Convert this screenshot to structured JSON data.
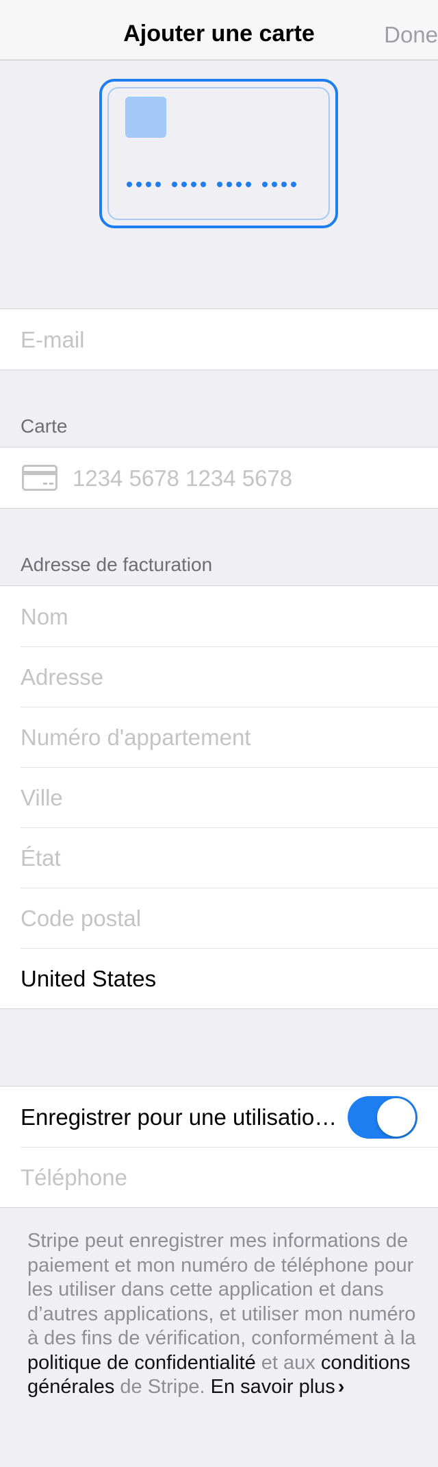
{
  "navbar": {
    "title": "Ajouter une carte",
    "done_label": "Done"
  },
  "email": {
    "placeholder": "E-mail"
  },
  "card_section": {
    "header": "Carte",
    "number_placeholder": "1234 5678 1234 5678"
  },
  "billing": {
    "header": "Adresse de facturation",
    "name_placeholder": "Nom",
    "address_placeholder": "Adresse",
    "apartment_placeholder": "Numéro d'appartement",
    "city_placeholder": "Ville",
    "state_placeholder": "État",
    "postal_placeholder": "Code postal",
    "country_value": "United States"
  },
  "save": {
    "label": "Enregistrer pour une utilisation ultérieure",
    "toggle_on": true,
    "phone_placeholder": "Téléphone"
  },
  "footer": {
    "text_1": "Stripe peut enregistrer mes informations de paiement et mon numéro de téléphone pour les utiliser dans cette application et dans d’autres applications, et utiliser mon numéro à des fins de vérification, conformément à la ",
    "privacy_link": "politique de confidentialité",
    "text_2": " et aux ",
    "terms_link": "conditions générales",
    "text_3": " de Stripe. ",
    "learn_more": "En savoir plus"
  },
  "colors": {
    "accent": "#1c7ef0",
    "background": "#efeff4",
    "placeholder": "#c4c4c7",
    "section_header": "#6d6d72"
  }
}
